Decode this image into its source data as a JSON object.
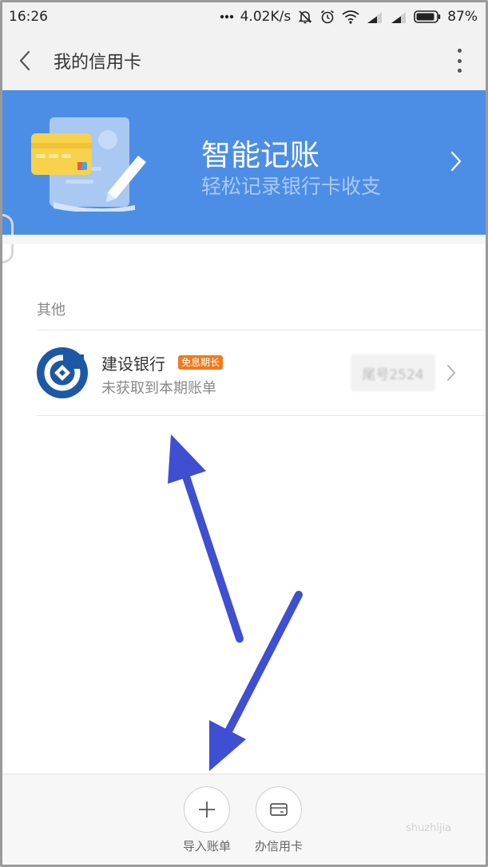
{
  "status_bar": {
    "time": "16:26",
    "network_speed": "4.02K/s",
    "battery": "87%",
    "icons": [
      "notification-dots-icon",
      "mute-bell-icon",
      "alarm-icon",
      "wifi-icon",
      "signal-icon",
      "signal-icon",
      "battery-icon"
    ]
  },
  "header": {
    "title": "我的信用卡",
    "back_icon": "chevron-left-icon",
    "menu_icon": "more-vertical-icon"
  },
  "banner": {
    "title": "智能记账",
    "subtitle": "轻松记录银行卡收支",
    "background": "#4c8ee6"
  },
  "section": {
    "label": "其他"
  },
  "card": {
    "bank_name": "建设银行",
    "tag": "免息期长",
    "status": "未获取到本期账单",
    "tail": "尾号2524",
    "logo_color": "#1d58a6",
    "tag_color": "#f07a1c"
  },
  "actions": [
    {
      "label": "导入账单",
      "icon": "plus-icon"
    },
    {
      "label": "办信用卡",
      "icon": "card-icon"
    }
  ],
  "annotation_color": "#3f4fd1",
  "watermark": "shuzhijia"
}
